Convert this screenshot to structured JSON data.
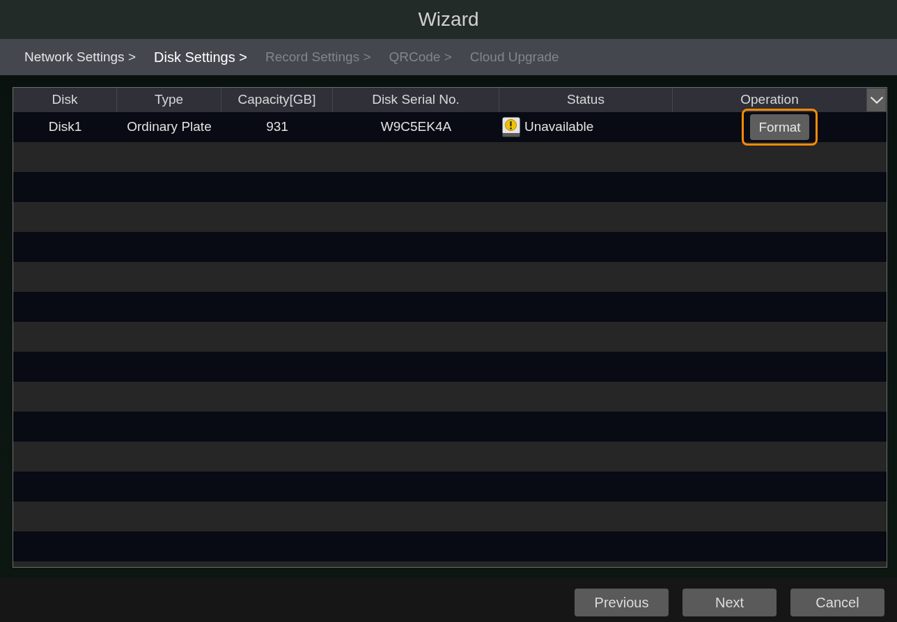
{
  "window": {
    "title": "Wizard"
  },
  "steps": [
    {
      "label": "Network Settings >",
      "selected": false,
      "disabled": false
    },
    {
      "label": "Disk Settings >",
      "selected": true,
      "disabled": false
    },
    {
      "label": "Record Settings >",
      "selected": false,
      "disabled": true
    },
    {
      "label": "QRCode >",
      "selected": false,
      "disabled": true
    },
    {
      "label": "Cloud Upgrade",
      "selected": false,
      "disabled": true
    }
  ],
  "table": {
    "columns": [
      "Disk",
      "Type",
      "Capacity[GB]",
      "Disk Serial No.",
      "Status",
      "Operation"
    ],
    "rows": [
      {
        "cells": [
          "Disk1",
          "Ordinary Plate",
          "931",
          "W9C5EK4A"
        ],
        "status": {
          "kind": "warning",
          "label": "Unavailable"
        },
        "operation": {
          "label": "Format",
          "highlighted": true
        }
      }
    ]
  },
  "buttons": [
    {
      "label": "Previous"
    },
    {
      "label": "Next"
    },
    {
      "label": "Cancel"
    }
  ]
}
